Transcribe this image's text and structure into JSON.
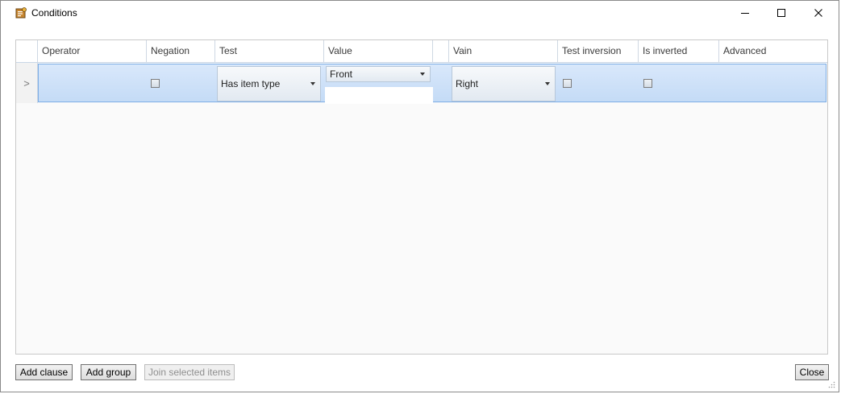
{
  "window": {
    "title": "Conditions",
    "controls": {
      "minimize": "—",
      "maximize": "☐",
      "close": "✕"
    }
  },
  "grid": {
    "columns": [
      {
        "key": "operator",
        "label": "Operator"
      },
      {
        "key": "negation",
        "label": "Negation"
      },
      {
        "key": "test",
        "label": "Test"
      },
      {
        "key": "value",
        "label": "Value"
      },
      {
        "key": "spacer",
        "label": ""
      },
      {
        "key": "vain",
        "label": "Vain"
      },
      {
        "key": "test_inversion",
        "label": "Test inversion"
      },
      {
        "key": "is_inverted",
        "label": "Is inverted"
      },
      {
        "key": "advanced",
        "label": "Advanced"
      }
    ],
    "rows": [
      {
        "indicator": ">",
        "operator": "",
        "negation_checked": false,
        "test": "Has item type",
        "value_select": "Front",
        "value_text": "",
        "vain": "Right",
        "test_inversion_checked": false,
        "is_inverted_checked": false,
        "advanced": ""
      }
    ]
  },
  "buttons": {
    "add_clause": "Add clause",
    "add_group": "Add group",
    "join_selected": "Join selected items",
    "close": "Close"
  },
  "icons": {
    "app": "conditions-app-icon",
    "dropdown": "dropdown-arrow-icon"
  },
  "colors": {
    "selection_fill": "#c4dbf6",
    "selection_border": "#7eaee5"
  }
}
